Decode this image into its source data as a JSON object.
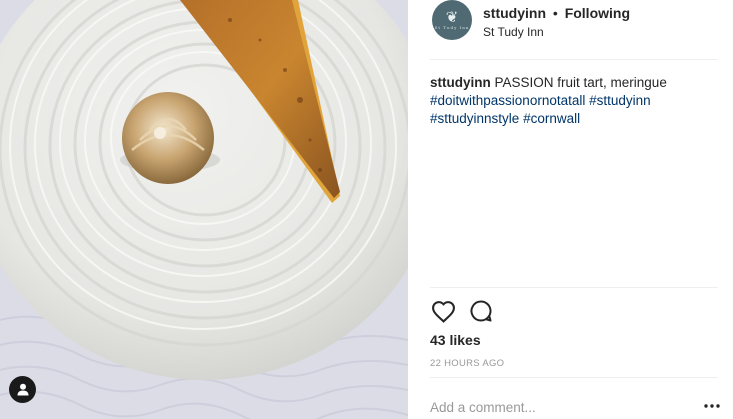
{
  "post": {
    "image_subject": "passion-fruit-tart-with-meringue-photo",
    "image_alt": "PASSION fruit tart, meringue"
  },
  "header": {
    "username": "sttudyinn",
    "separator": "•",
    "follow_status": "Following",
    "location": "St Tudy Inn",
    "avatar_wordmark": "St Tudy Inn"
  },
  "caption": {
    "username": "sttudyinn",
    "text": "PASSION fruit tart, meringue",
    "hashtags": [
      "#doitwithpassionornotatall",
      "#sttudyinn",
      "#sttudyinnstyle",
      "#cornwall"
    ]
  },
  "actions": {
    "like_icon": "heart-icon",
    "comment_icon": "speech-bubble-icon"
  },
  "likes": "43 likes",
  "timestamp": "22 HOURS AGO",
  "comment": {
    "placeholder": "Add a comment...",
    "value": ""
  },
  "colors": {
    "hashtag": "#003569",
    "muted": "#999999",
    "text": "#262626",
    "avatar_bg": "#4f6a72"
  }
}
